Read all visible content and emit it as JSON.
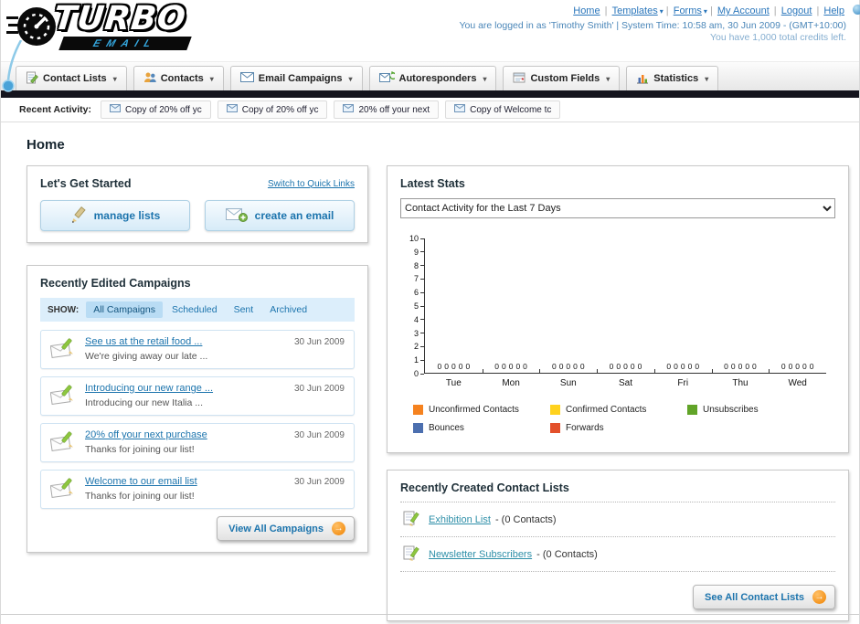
{
  "header": {
    "logo": {
      "line1": "TURBO",
      "line2": "EMAIL"
    },
    "nav": [
      "Home",
      "Templates",
      "Forms",
      "My Account",
      "Logout",
      "Help"
    ],
    "login_info": "You are logged in as 'Timothy Smith' | System Time: 10:58 am, 30 Jun 2009 - (GMT+10:00)",
    "credits": "You have 1,000 total credits left."
  },
  "main_nav": [
    {
      "label": "Contact Lists"
    },
    {
      "label": "Contacts"
    },
    {
      "label": "Email Campaigns"
    },
    {
      "label": "Autoresponders"
    },
    {
      "label": "Custom Fields"
    },
    {
      "label": "Statistics"
    }
  ],
  "recent_activity": {
    "label": "Recent Activity:",
    "items": [
      "Copy of 20% off yc",
      "Copy of 20% off yc",
      "20% off your next",
      "Copy of Welcome tc"
    ]
  },
  "page_title": "Home",
  "get_started": {
    "title": "Let's Get Started",
    "switch_link": "Switch to Quick Links",
    "manage_lists_label": "manage lists",
    "create_email_label": "create an email"
  },
  "campaigns": {
    "title": "Recently Edited Campaigns",
    "show_label": "SHOW:",
    "tabs": [
      "All Campaigns",
      "Scheduled",
      "Sent",
      "Archived"
    ],
    "active_tab": "All Campaigns",
    "items": [
      {
        "title": "See us at the retail food ...",
        "subtitle": "We're giving away our late ...",
        "date": "30 Jun 2009"
      },
      {
        "title": "Introducing our new range ...",
        "subtitle": "Introducing our new Italia ...",
        "date": "30 Jun 2009"
      },
      {
        "title": "20% off your next purchase",
        "subtitle": "Thanks for joining our list!",
        "date": "30 Jun 2009"
      },
      {
        "title": "Welcome to our email list",
        "subtitle": "Thanks for joining our list!",
        "date": "30 Jun 2009"
      }
    ],
    "view_all_label": "View All Campaigns"
  },
  "stats": {
    "title": "Latest Stats",
    "dropdown_value": "Contact Activity for the Last 7 Days",
    "chart_data": {
      "type": "bar",
      "categories": [
        "Tue",
        "Mon",
        "Sun",
        "Sat",
        "Fri",
        "Thu",
        "Wed"
      ],
      "series": [
        {
          "name": "Unconfirmed Contacts",
          "color": "#f5821f",
          "values": [
            0,
            0,
            0,
            0,
            0,
            0,
            0
          ]
        },
        {
          "name": "Confirmed Contacts",
          "color": "#ffd21e",
          "values": [
            0,
            0,
            0,
            0,
            0,
            0,
            0
          ]
        },
        {
          "name": "Unsubscribes",
          "color": "#61a428",
          "values": [
            0,
            0,
            0,
            0,
            0,
            0,
            0
          ]
        },
        {
          "name": "Bounces",
          "color": "#4c6faf",
          "values": [
            0,
            0,
            0,
            0,
            0,
            0,
            0
          ]
        },
        {
          "name": "Forwards",
          "color": "#e3502b",
          "values": [
            0,
            0,
            0,
            0,
            0,
            0,
            0
          ]
        }
      ],
      "ylim": [
        0,
        10
      ],
      "ylabel": "",
      "xlabel": "",
      "grid": false,
      "legend_position": "bottom"
    }
  },
  "contact_lists": {
    "title": "Recently Created Contact Lists",
    "items": [
      {
        "name": "Exhibition List",
        "suffix": "- (0 Contacts)"
      },
      {
        "name": "Newsletter Subscribers",
        "suffix": "- (0 Contacts)"
      }
    ],
    "see_all_label": "See All Contact Lists"
  }
}
